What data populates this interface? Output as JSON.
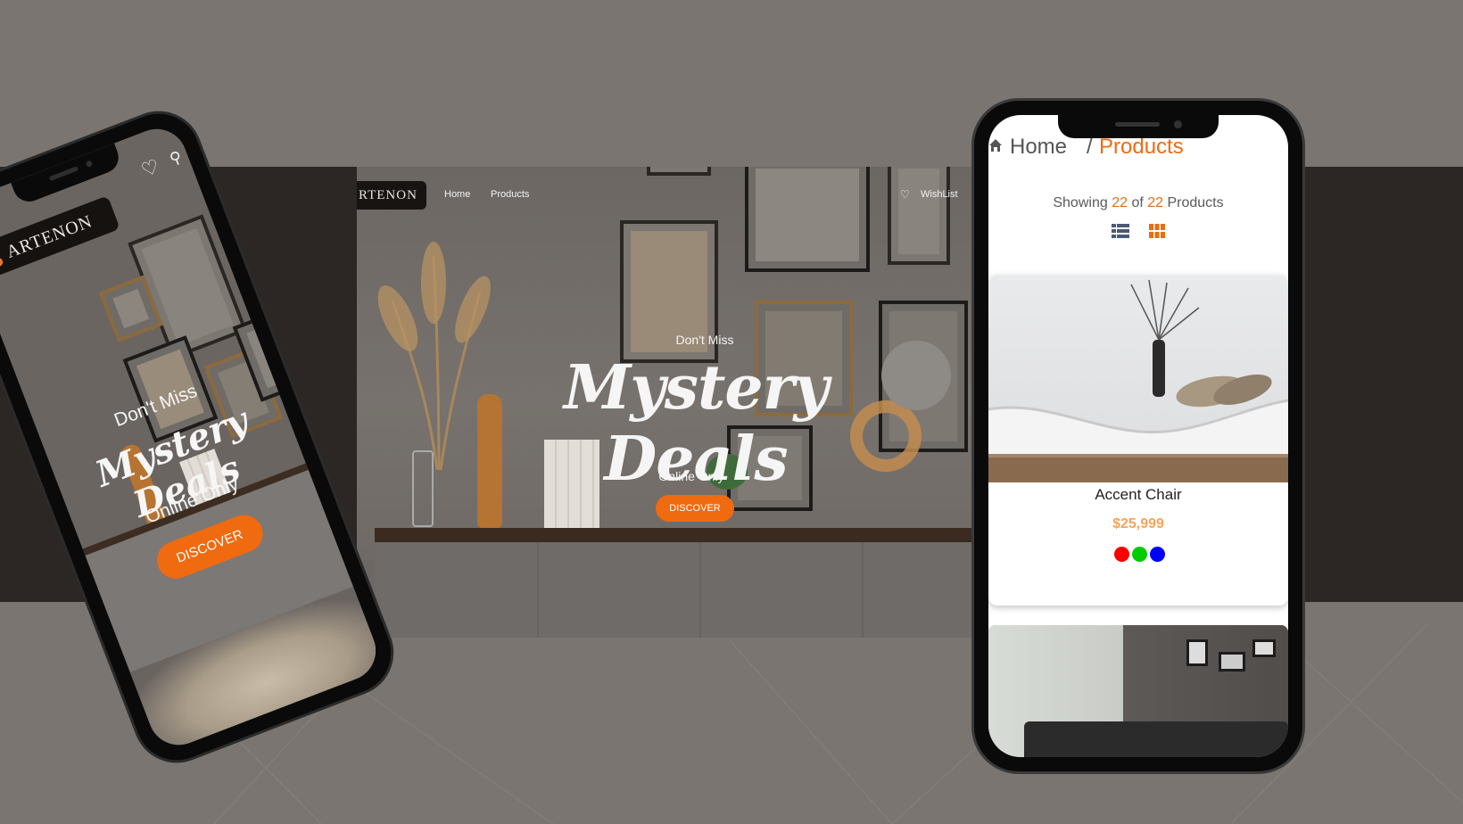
{
  "colors": {
    "accent": "#f06a10",
    "price": "#f7a35c",
    "background": "#7a7571",
    "band": "#2c2724"
  },
  "desktop": {
    "brand_partial": "RTENON",
    "nav": {
      "home": "Home",
      "products": "Products",
      "wishlist": "WishList"
    },
    "hero": {
      "eyebrow": "Don't Miss",
      "title": "Mystery Deals",
      "subtitle": "Online Only",
      "cta": "DISCOVER"
    }
  },
  "mobile_home": {
    "brand": "ARTENON",
    "icons": [
      "heart-icon",
      "cart-icon"
    ],
    "hero": {
      "eyebrow": "Don't Miss",
      "title": "Mystery Deals",
      "subtitle": "Online Only",
      "cta": "DISCOVER"
    }
  },
  "mobile_products": {
    "breadcrumb": {
      "home": "Home",
      "separator": "/",
      "current": "Products"
    },
    "showing": {
      "prefix": "Showing",
      "count": "22",
      "of": "of",
      "total": "22",
      "suffix": "Products"
    },
    "view_toggle": [
      "list-view-icon",
      "grid-view-icon"
    ],
    "products": [
      {
        "name": "Accent Chair",
        "price": "$25,999",
        "colors": [
          "#ff0000",
          "#00cc00",
          "#0000ff"
        ]
      }
    ]
  }
}
